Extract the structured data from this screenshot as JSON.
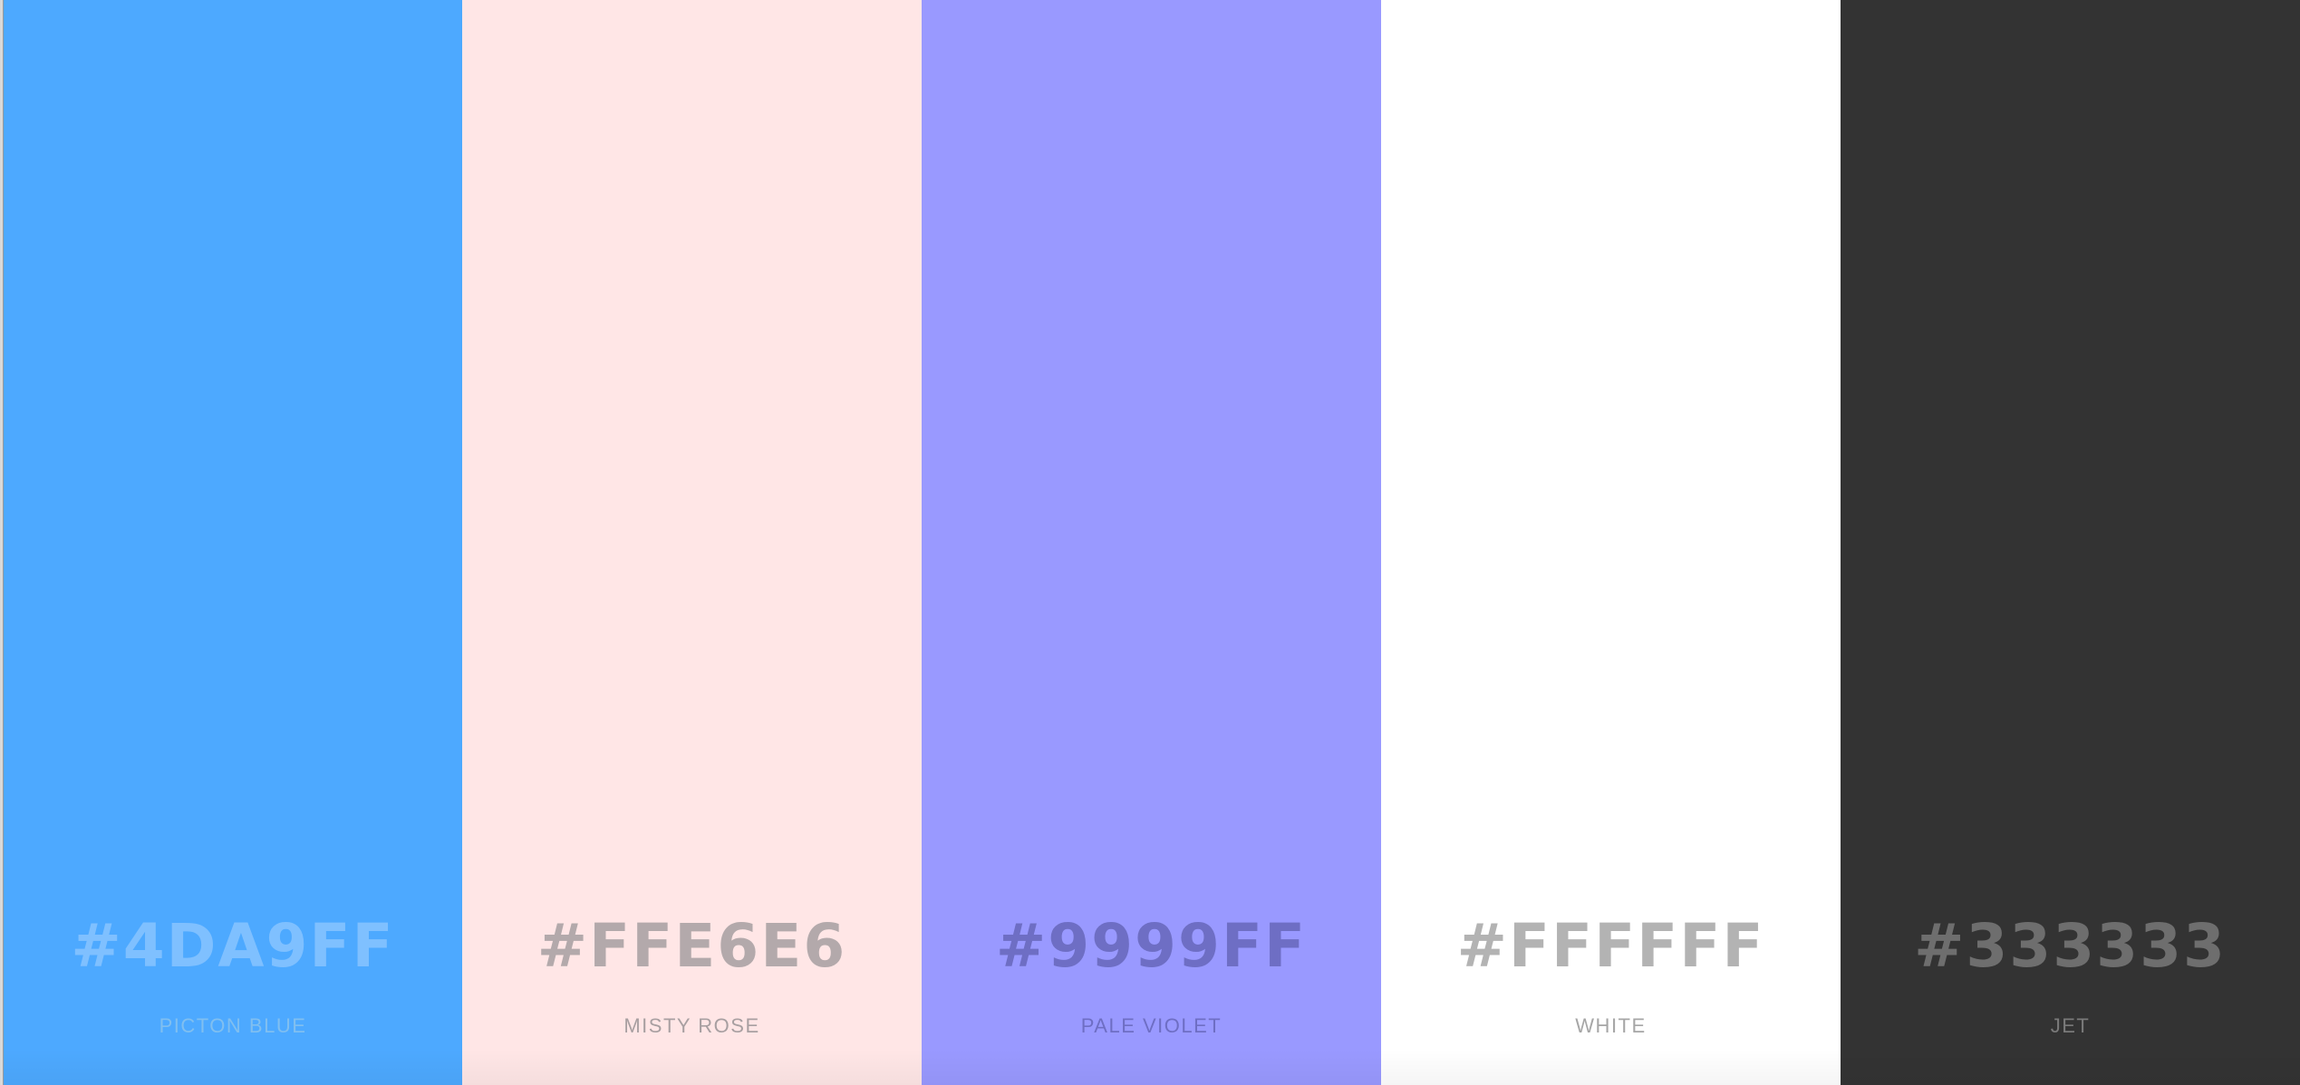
{
  "palette": [
    {
      "hex": "#4DA9FF",
      "name": "PICTON BLUE",
      "color": "#4DA9FF",
      "hex_text_color": "#7fc0ff",
      "name_text_color": "#80bff0"
    },
    {
      "hex": "#FFE6E6",
      "name": "MISTY ROSE",
      "color": "#FFE6E6",
      "hex_text_color": "#b3a9ab",
      "name_text_color": "#a89fa1"
    },
    {
      "hex": "#9999FF",
      "name": "PALE VIOLET",
      "color": "#9999FF",
      "hex_text_color": "#6e6ec4",
      "name_text_color": "#6e6ec4"
    },
    {
      "hex": "#FFFFFF",
      "name": "WHITE",
      "color": "#FFFFFF",
      "hex_text_color": "#b3b3b3",
      "name_text_color": "#a6a6a6"
    },
    {
      "hex": "#333333",
      "name": "JET",
      "color": "#333333",
      "hex_text_color": "#6e6e6e",
      "name_text_color": "#7a7a7a"
    }
  ]
}
